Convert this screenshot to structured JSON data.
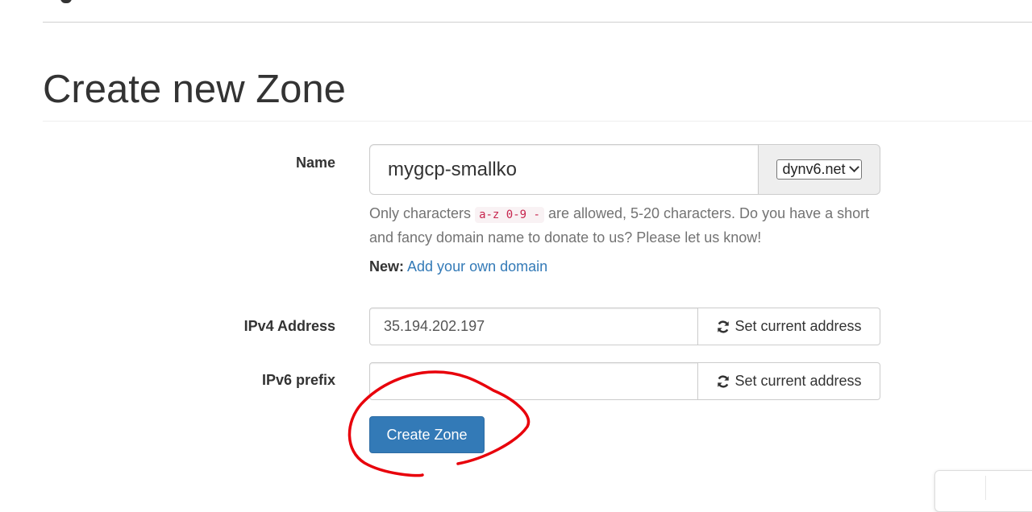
{
  "page": {
    "title": "Create new Zone"
  },
  "form": {
    "name": {
      "label": "Name",
      "value": "mygcp-smallko",
      "domain_select": "dynv6.net",
      "help_prefix": "Only characters",
      "help_allowed": "a-z 0-9 -",
      "help_suffix": "are allowed, 5-20 characters. Do you have a short and fancy domain name to donate to us? Please let us know!",
      "new_label": "New:",
      "new_link": "Add your own domain"
    },
    "ipv4": {
      "label": "IPv4 Address",
      "value": "35.194.202.197",
      "button": "Set current address"
    },
    "ipv6": {
      "label": "IPv6 prefix",
      "value": "",
      "button": "Set current address"
    },
    "submit": "Create Zone"
  },
  "icons": {
    "refresh": "refresh-icon",
    "dropdown": "chevron-down-icon"
  },
  "colors": {
    "primary": "#337ab7",
    "annotation": "#e8000b",
    "code": "#c7254e"
  }
}
